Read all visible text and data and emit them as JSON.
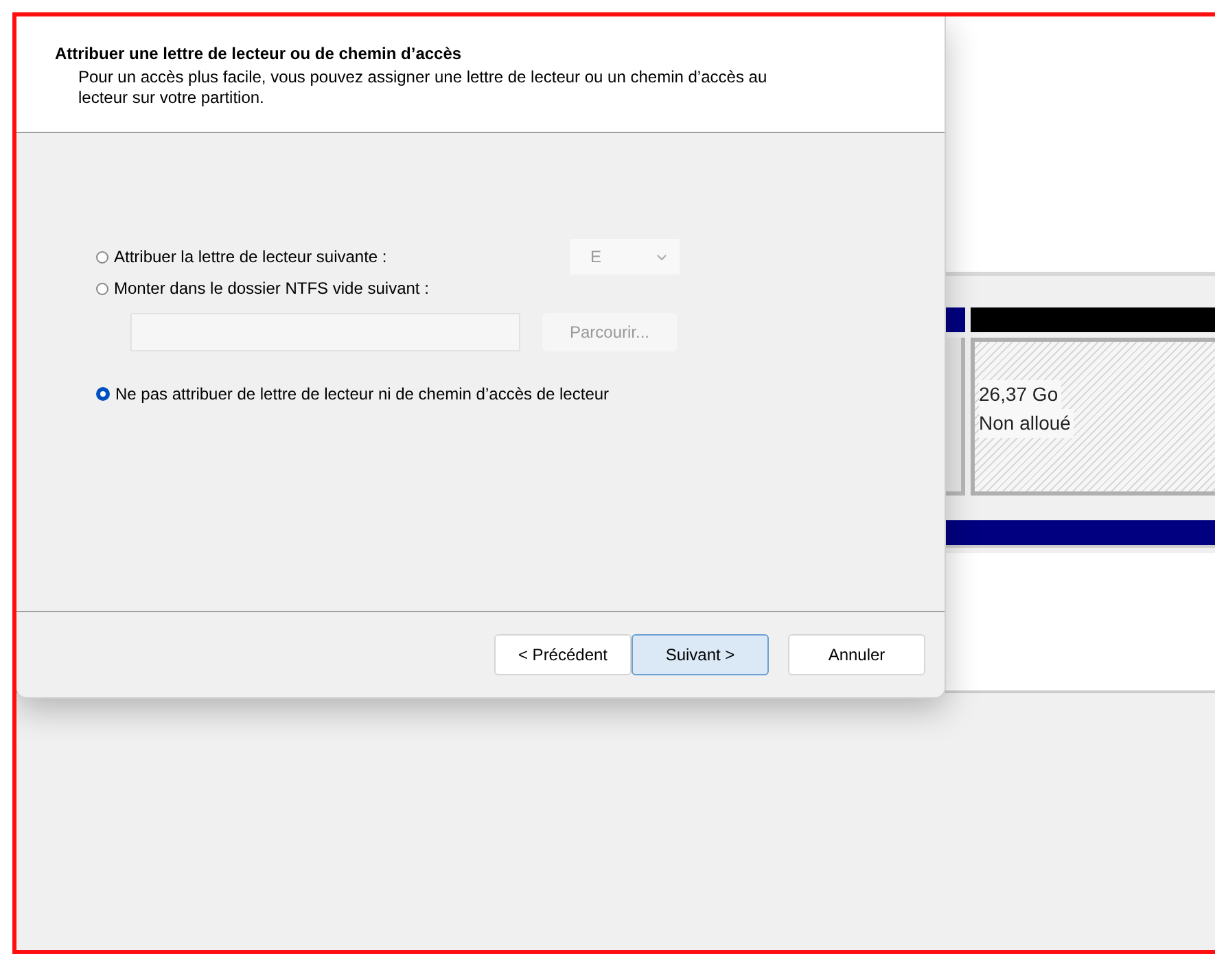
{
  "dialog": {
    "title": "Attribuer une lettre de lecteur ou de chemin d’accès",
    "subtitle": "Pour un accès plus facile, vous pouvez assigner une lettre de lecteur ou un chemin d’accès au lecteur sur votre partition.",
    "options": [
      {
        "kind": "letter",
        "label": "Attribuer la lettre de lecteur suivante :",
        "selected": false,
        "letter": "E",
        "disabled": true
      },
      {
        "kind": "folder",
        "label": "Monter dans le dossier NTFS vide suivant :",
        "selected": false,
        "browse": "Parcourir...",
        "disabled": true
      },
      {
        "kind": "none",
        "label": "Ne pas attribuer de lettre de lecteur ni de chemin d’accès de lecteur",
        "selected": true
      }
    ],
    "buttons": [
      {
        "label": "< Précédent",
        "default": false
      },
      {
        "label": "Suivant >",
        "default": true
      },
      {
        "label": "Annuler",
        "default": false
      }
    ]
  },
  "disk_view": {
    "partition": {
      "size": "26,37 Go",
      "status": "Non alloué"
    }
  }
}
